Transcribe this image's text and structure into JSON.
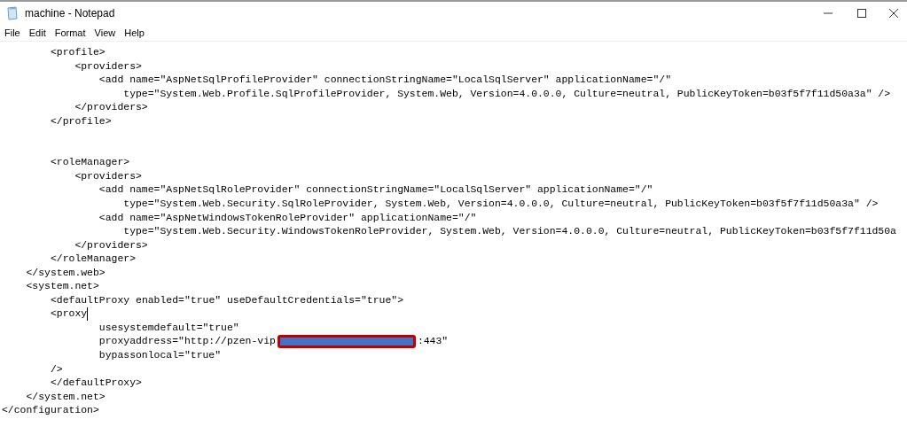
{
  "window": {
    "title": "machine - Notepad"
  },
  "menu": [
    "File",
    "Edit",
    "Format",
    "View",
    "Help"
  ],
  "lines": [
    {
      "segments": [
        {
          "kind": "text",
          "text": "        <profile>"
        }
      ]
    },
    {
      "segments": [
        {
          "kind": "text",
          "text": "            <providers>"
        }
      ]
    },
    {
      "segments": [
        {
          "kind": "text",
          "text": "                <add name=\"AspNetSqlProfileProvider\" connectionStringName=\"LocalSqlServer\" applicationName=\"/\""
        }
      ]
    },
    {
      "segments": [
        {
          "kind": "text",
          "text": "                    type=\"System.Web.Profile.SqlProfileProvider, System.Web, Version=4.0.0.0, Culture=neutral, PublicKeyToken=b03f5f7f11d50a3a\" />"
        }
      ]
    },
    {
      "segments": [
        {
          "kind": "text",
          "text": "            </providers>"
        }
      ]
    },
    {
      "segments": [
        {
          "kind": "text",
          "text": "        </profile>"
        }
      ]
    },
    {
      "kind": "blank"
    },
    {
      "kind": "blank"
    },
    {
      "segments": [
        {
          "kind": "text",
          "text": "        <roleManager>"
        }
      ]
    },
    {
      "segments": [
        {
          "kind": "text",
          "text": "            <providers>"
        }
      ]
    },
    {
      "segments": [
        {
          "kind": "text",
          "text": "                <add name=\"AspNetSqlRoleProvider\" connectionStringName=\"LocalSqlServer\" applicationName=\"/\""
        }
      ]
    },
    {
      "segments": [
        {
          "kind": "text",
          "text": "                    type=\"System.Web.Security.SqlRoleProvider, System.Web, Version=4.0.0.0, Culture=neutral, PublicKeyToken=b03f5f7f11d50a3a\" />"
        }
      ]
    },
    {
      "segments": [
        {
          "kind": "text",
          "text": "                <add name=\"AspNetWindowsTokenRoleProvider\" applicationName=\"/\""
        }
      ]
    },
    {
      "segments": [
        {
          "kind": "text",
          "text": "                    type=\"System.Web.Security.WindowsTokenRoleProvider, System.Web, Version=4.0.0.0, Culture=neutral, PublicKeyToken=b03f5f7f11d50a"
        }
      ]
    },
    {
      "segments": [
        {
          "kind": "text",
          "text": "            </providers>"
        }
      ]
    },
    {
      "segments": [
        {
          "kind": "text",
          "text": "        </roleManager>"
        }
      ]
    },
    {
      "segments": [
        {
          "kind": "text",
          "text": "    </system.web>"
        }
      ]
    },
    {
      "segments": [
        {
          "kind": "text",
          "text": "    <system.net>"
        }
      ]
    },
    {
      "segments": [
        {
          "kind": "text",
          "text": "        <defaultProxy enabled=\"true\" useDefaultCredentials=\"true\">"
        }
      ]
    },
    {
      "segments": [
        {
          "kind": "text",
          "text": "        <proxy"
        },
        {
          "kind": "cursor"
        }
      ]
    },
    {
      "segments": [
        {
          "kind": "text",
          "text": "                usesystemdefault=\"true\""
        }
      ]
    },
    {
      "segments": [
        {
          "kind": "text",
          "text": "                proxyaddress=\"http://pzen-vip"
        },
        {
          "kind": "redaction"
        },
        {
          "kind": "text",
          "text": ":443\""
        }
      ]
    },
    {
      "segments": [
        {
          "kind": "text",
          "text": "                bypassonlocal=\"true\""
        }
      ]
    },
    {
      "segments": [
        {
          "kind": "text",
          "text": "        />"
        }
      ]
    },
    {
      "segments": [
        {
          "kind": "text",
          "text": "        </defaultProxy>"
        }
      ]
    },
    {
      "segments": [
        {
          "kind": "text",
          "text": "    </system.net>"
        }
      ]
    },
    {
      "segments": [
        {
          "kind": "text",
          "text": "</configuration>"
        }
      ]
    }
  ]
}
